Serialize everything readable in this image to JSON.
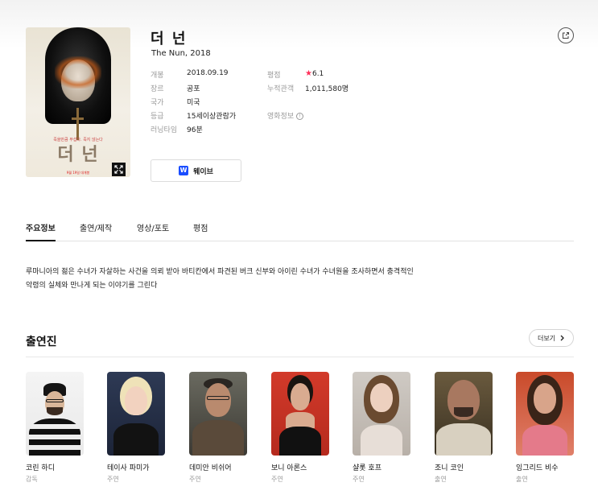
{
  "movie": {
    "title": "더 넌",
    "subtitle": "The Nun, 2018",
    "poster": {
      "title_text": "더 넌",
      "tagline": "죽을만큼 무섭다. 죽지 않는다",
      "date_text": "9월 19일 대개봉"
    }
  },
  "info": {
    "left": [
      {
        "label": "개봉",
        "value": "2018.09.19"
      },
      {
        "label": "장르",
        "value": "공포"
      },
      {
        "label": "국가",
        "value": "미국"
      },
      {
        "label": "등급",
        "value": "15세이상관람가"
      },
      {
        "label": "러닝타임",
        "value": "96분"
      }
    ],
    "right": [
      {
        "label": "평점",
        "value": "6.1"
      },
      {
        "label": "누적관객",
        "value": "1,011,580명"
      },
      {
        "label": "영화정보",
        "value": "!"
      }
    ]
  },
  "watch_button": {
    "logo": "W",
    "label": "웨이브"
  },
  "tabs": [
    "주요정보",
    "출연/제작",
    "영상/포토",
    "평점"
  ],
  "synopsis": {
    "line1": "루마니아의 젊은 수녀가 자살하는 사건을 의뢰 받아 바티칸에서 파견된 버크 신부와 아이린 수녀가 수녀원을 조사하면서 충격적인",
    "line2": "악령의 실체와 만나게 되는 이야기를 그린다"
  },
  "cast_section": {
    "title": "출연진",
    "more_label": "더보기",
    "members": [
      {
        "name": "코린 하디",
        "role": "감독"
      },
      {
        "name": "테이사 파미가",
        "role": "주연"
      },
      {
        "name": "데미안 비쉬어",
        "role": "주연"
      },
      {
        "name": "보니 아론스",
        "role": "주연"
      },
      {
        "name": "샬롯 호프",
        "role": "주연"
      },
      {
        "name": "조니 코인",
        "role": "출연"
      },
      {
        "name": "잉그리드 비수",
        "role": "출연"
      }
    ]
  },
  "colors": {
    "rating_star": "#ff2f5a",
    "wavve_blue": "#1a4dff"
  },
  "icons": [
    "share-icon",
    "expand-icon",
    "star-icon",
    "info-icon",
    "chevron-right-icon",
    "wavve-logo-icon"
  ]
}
